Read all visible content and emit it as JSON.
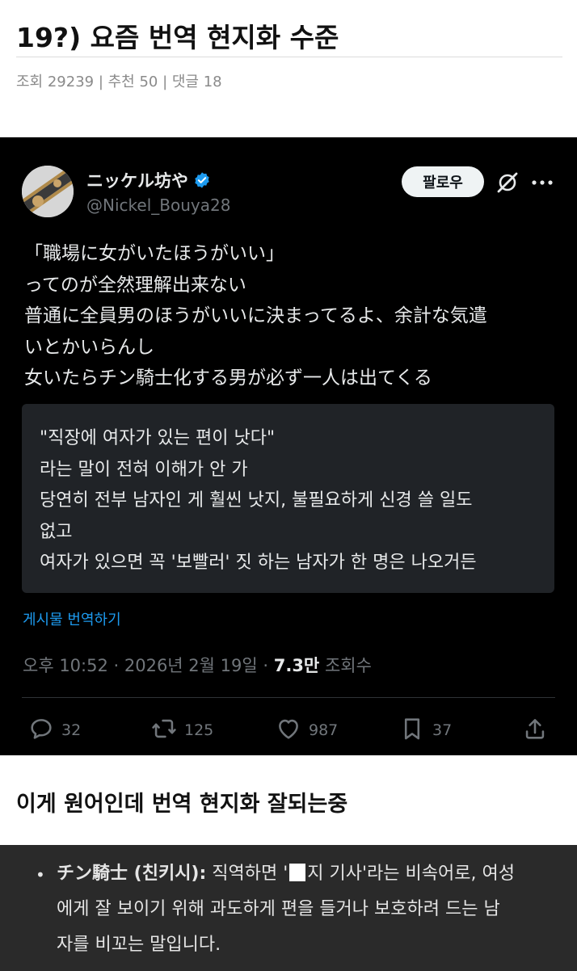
{
  "post": {
    "title": "19?) 요즘 번역 현지화 수준",
    "meta": "조회 29239 | 추천 50 | 댓글 18"
  },
  "tweet": {
    "display_name": "ニッケル坊や",
    "handle": "@Nickel_Bouya28",
    "follow_label": "팔로우",
    "text_lines": [
      "「職場に女がいたほうがいい」",
      "ってのが全然理解出来ない",
      "普通に全員男のほうがいいに決まってるよ、余計な気遣",
      "いとかいらんし",
      "女いたらチン騎士化する男が必ず一人は出てくる"
    ],
    "translation_lines": [
      "\"직장에 여자가 있는 편이 낫다\"",
      "라는 말이 전혀 이해가 안 가",
      "당연히 전부 남자인 게 훨씬 낫지, 불필요하게 신경 쓸 일도",
      "없고",
      "여자가 있으면 꼭 '보빨러' 짓 하는 남자가 한 명은 나오거든"
    ],
    "translate_link": "게시물 번역하기",
    "timestamp": "오후 10:52 · 2026년 2월 19일 · ",
    "views_count": "7.3만",
    "views_label": " 조회수",
    "actions": {
      "reply_count": "32",
      "retweet_count": "125",
      "like_count": "987",
      "bookmark_count": "37"
    },
    "icons": {
      "verified": "verified-badge-icon",
      "grok": "grok-icon",
      "more": "more-icon",
      "reply": "reply-icon",
      "retweet": "retweet-icon",
      "like": "heart-icon",
      "bookmark": "bookmark-icon",
      "share": "share-icon"
    },
    "colors": {
      "background": "#000000",
      "link": "#1d9bf0",
      "verified": "#1d9bf0",
      "translation_box": "#202327"
    }
  },
  "caption": "이게 원어인데 번역 현지화 잘되는중",
  "explanation": {
    "term": "チン騎士 (친키시):",
    "line1_a": " 직역하면 '",
    "line1_b": "지 기사'라는 비속어로, 여성",
    "line2": "에게 잘 보이기 위해 과도하게 편을 들거나 보호하려 드는 남",
    "line3": "자를 비꼬는 말입니다."
  }
}
